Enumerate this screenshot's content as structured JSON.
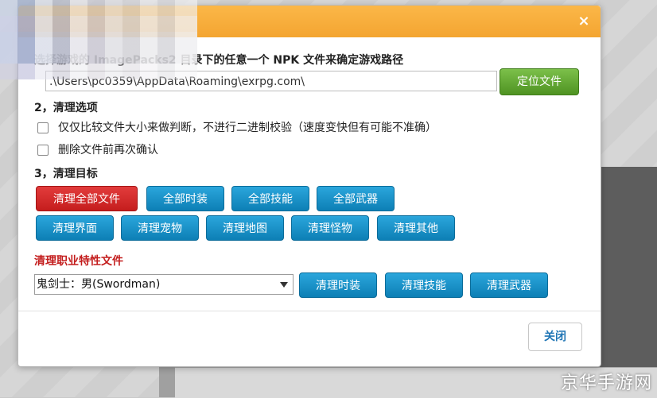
{
  "dialog": {
    "instruction": "选择游戏的 ImagePacks2 目录下的任意一个 NPK 文件来确定游戏路径",
    "path_value": ".\\Users\\pc0359\\AppData\\Roaming\\exrpg.com\\",
    "locate_label": "定位文件",
    "close_icon": "×",
    "close_label": "关闭"
  },
  "section2": {
    "title": "2，清理选项",
    "options": [
      "仅仅比较文件大小来做判断，不进行二进制校验（速度变快但有可能不准确）",
      "删除文件前再次确认"
    ]
  },
  "section3": {
    "title": "3，清理目标",
    "row1": [
      "清理全部文件",
      "全部时装",
      "全部技能",
      "全部武器"
    ],
    "row2": [
      "清理界面",
      "清理宠物",
      "清理地图",
      "清理怪物",
      "清理其他"
    ]
  },
  "career": {
    "title": "清理职业特性文件",
    "selected": "鬼剑士：男(Swordman)",
    "buttons": [
      "清理时装",
      "清理技能",
      "清理武器"
    ]
  },
  "watermark": "京华手游网",
  "colors": {
    "title_bar": "#f4a531",
    "primary_button": "#1590c9",
    "danger_button": "#d62b2b",
    "success_button": "#5fa52d",
    "career_title": "#c31d1d"
  }
}
